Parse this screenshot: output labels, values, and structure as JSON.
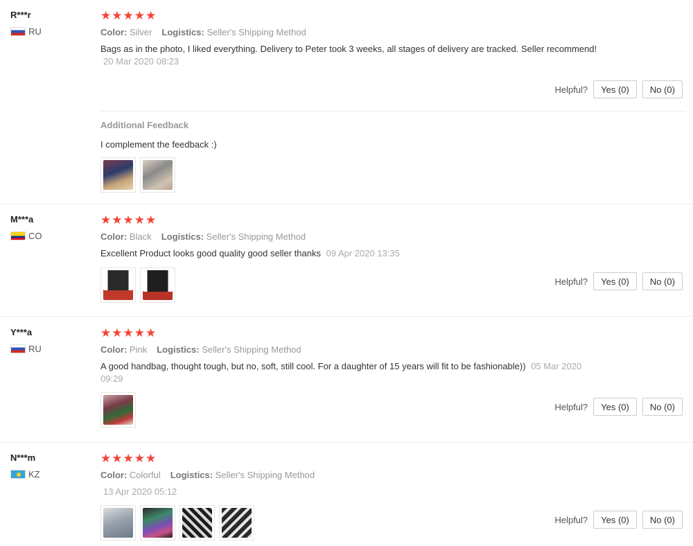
{
  "labels": {
    "color": "Color:",
    "logistics": "Logistics:",
    "helpful": "Helpful?",
    "additional": "Additional Feedback"
  },
  "reviews": [
    {
      "user": "R***r",
      "country": "RU",
      "flag": "ru",
      "stars": 5,
      "color": "Silver",
      "logistics": "Seller's Shipping Method",
      "text": "Bags as in the photo, I liked everything. Delivery to Peter took 3 weeks, all stages of delivery are tracked. Seller recommend!",
      "date": "20 Mar 2020 08:23",
      "yes": "Yes (0)",
      "no": "No (0)",
      "additional_text": "I complement the feedback :)"
    },
    {
      "user": "M***a",
      "country": "CO",
      "flag": "co",
      "stars": 5,
      "color": "Black",
      "logistics": "Seller's Shipping Method",
      "text": "Excellent Product looks good quality good seller thanks",
      "date": "09 Apr 2020 13:35",
      "yes": "Yes (0)",
      "no": "No (0)"
    },
    {
      "user": "Y***a",
      "country": "RU",
      "flag": "ru",
      "stars": 5,
      "color": "Pink",
      "logistics": "Seller's Shipping Method",
      "text": "A good handbag, thought tough, but no, soft, still cool. For a daughter of 15 years will fit to be fashionable))",
      "date": "05 Mar 2020 09:29",
      "yes": "Yes (0)",
      "no": "No (0)"
    },
    {
      "user": "N***m",
      "country": "KZ",
      "flag": "kz",
      "stars": 5,
      "color": "Colorful",
      "logistics": "Seller's Shipping Method",
      "text": "",
      "date": "13 Apr 2020 05:12",
      "yes": "Yes (0)",
      "no": "No (0)"
    }
  ],
  "star_glyph": "★"
}
